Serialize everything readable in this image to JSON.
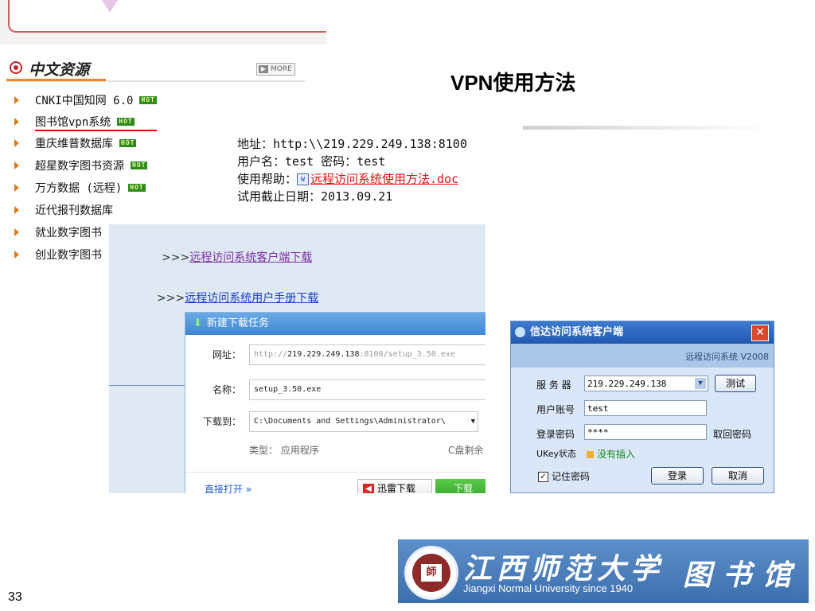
{
  "slide": {
    "title": "VPN使用方法",
    "page_number": "33"
  },
  "resources": {
    "heading": "中文资源",
    "more_label": "MORE",
    "hot_label": "HOT",
    "items": [
      {
        "label": "CNKI中国知网 6.0",
        "hot": true
      },
      {
        "label": "图书馆vpn系统",
        "hot": true
      },
      {
        "label": "重庆维普数据库",
        "hot": true
      },
      {
        "label": "超星数字图书资源",
        "hot": true
      },
      {
        "label": "万方数据 (远程)",
        "hot": true
      },
      {
        "label": "近代报刊数据库",
        "hot": false
      },
      {
        "label": "就业数字图书",
        "hot": false
      },
      {
        "label": "创业数字图书",
        "hot": false
      }
    ]
  },
  "info": {
    "address_label": "地址：",
    "address_value": "http:\\\\219.229.249.138:8100",
    "user_label": "用户名：",
    "user_value": "test",
    "password_label": "密码：",
    "password_value": "test",
    "help_label": "使用帮助：",
    "help_link": "远程访问系统使用方法.doc",
    "expiry_label": "试用截止日期：",
    "expiry_value": "2013.09.21"
  },
  "downloads": {
    "prefix": ">>>",
    "client_link": "远程访问系统客户端下载",
    "manual_link": "远程访问系统用户手册下载"
  },
  "task_dialog": {
    "title": "新建下载任务",
    "url_label": "网址：",
    "url_prefix": "http://",
    "url_host": "219.229.249.138",
    "url_suffix": ":8100/setup_3.50.exe",
    "name_label": "名称：",
    "name_value": "setup_3.50.exe",
    "save_label": "下载到：",
    "save_value": "C:\\Documents and Settings\\Administrator\\",
    "type_label": "类型：",
    "type_value": "应用程序",
    "disk_label": "C盘剩余",
    "open_direct": "直接打开",
    "xunlei_label": "迅雷下载",
    "download_label": "下载"
  },
  "client_dialog": {
    "title": "信达访问系统客户端",
    "subtitle": "远程访问系统 V2008",
    "server_label": "服 务 器",
    "server_value": "219.229.249.138",
    "test_button": "测试",
    "account_label": "用户账号",
    "account_value": "test",
    "password_label": "登录密码",
    "password_value": "****",
    "retrieve_label": "取回密码",
    "ukey_label": "UKey状态",
    "ukey_value": "没有插入",
    "remember_label": "记住密码",
    "login_button": "登录",
    "cancel_button": "取消"
  },
  "banner": {
    "university_cn": "江西师范大学",
    "university_en": "Jiangxi Normal University  since 1940",
    "library_cn": "图书馆"
  },
  "colors": {
    "accent_red": "#c0272d",
    "hot_green": "#2e8b1c",
    "link_purple": "#7b2fa0",
    "banner_blue": "#4a7fbd"
  }
}
